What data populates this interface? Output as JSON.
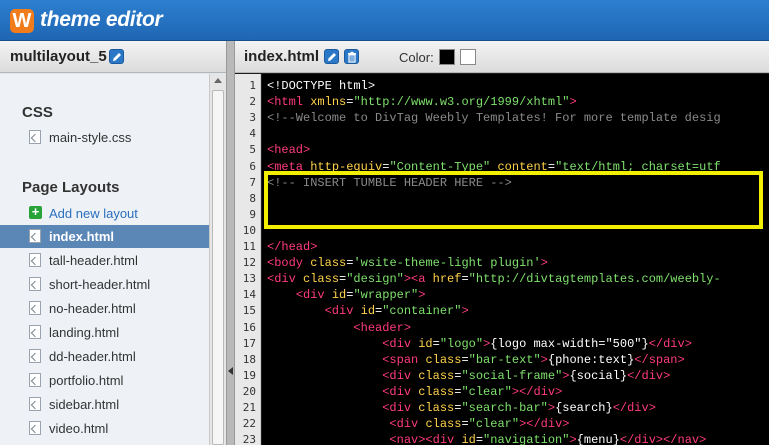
{
  "app": {
    "logo_letter": "W",
    "title": "theme editor"
  },
  "sidebar": {
    "project_name": "multilayout_5",
    "css_section": "CSS",
    "css_files": [
      "main-style.css"
    ],
    "layouts_section": "Page Layouts",
    "add_layout_label": "Add new layout",
    "layout_files": [
      "index.html",
      "tall-header.html",
      "short-header.html",
      "no-header.html",
      "landing.html",
      "dd-header.html",
      "portfolio.html",
      "sidebar.html",
      "video.html"
    ],
    "selected_index": 0
  },
  "editor": {
    "file_name": "index.html",
    "color_label": "Color:",
    "swatches": [
      "#000000",
      "#ffffff"
    ],
    "highlight_color": "#f2ef00",
    "lines": [
      {
        "n": "1",
        "tokens": [
          [
            "text",
            "<!DOCTYPE html>"
          ]
        ]
      },
      {
        "n": "2",
        "tokens": [
          [
            "tag",
            "<html "
          ],
          [
            "attr",
            "xmlns"
          ],
          [
            "text",
            "="
          ],
          [
            "str",
            "\"http://www.w3.org/1999/xhtml\""
          ],
          [
            "tag",
            ">"
          ]
        ]
      },
      {
        "n": "3",
        "tokens": [
          [
            "comment",
            "<!--Welcome to DivTag Weebly Templates! For more template desig"
          ]
        ]
      },
      {
        "n": "4",
        "tokens": []
      },
      {
        "n": "5",
        "tokens": [
          [
            "tag",
            "<head>"
          ]
        ]
      },
      {
        "n": "6",
        "tokens": [
          [
            "tag",
            "<meta "
          ],
          [
            "attr",
            "http-equiv"
          ],
          [
            "text",
            "="
          ],
          [
            "str",
            "\"Content-Type\""
          ],
          [
            "text",
            " "
          ],
          [
            "attr",
            "content"
          ],
          [
            "text",
            "="
          ],
          [
            "str",
            "\"text/html; charset=utf"
          ]
        ]
      },
      {
        "n": "7",
        "tokens": [
          [
            "comment",
            "<!-- INSERT TUMBLE HEADER HERE -->"
          ]
        ]
      },
      {
        "n": "8",
        "tokens": []
      },
      {
        "n": "9",
        "tokens": []
      },
      {
        "n": "10",
        "tokens": []
      },
      {
        "n": "11",
        "tokens": [
          [
            "tag",
            "</head>"
          ]
        ]
      },
      {
        "n": "12",
        "tokens": [
          [
            "tag",
            "<body "
          ],
          [
            "attr",
            "class"
          ],
          [
            "text",
            "="
          ],
          [
            "str",
            "'wsite-theme-light plugin'"
          ],
          [
            "tag",
            ">"
          ]
        ]
      },
      {
        "n": "13",
        "tokens": [
          [
            "tag",
            "<div "
          ],
          [
            "attr",
            "class"
          ],
          [
            "text",
            "="
          ],
          [
            "str",
            "\"design\""
          ],
          [
            "tag",
            "><a "
          ],
          [
            "attr",
            "href"
          ],
          [
            "text",
            "="
          ],
          [
            "str",
            "\"http://divtagtemplates.com/weebly-"
          ]
        ]
      },
      {
        "n": "14",
        "tokens": [
          [
            "text",
            "    "
          ],
          [
            "tag",
            "<div "
          ],
          [
            "attr",
            "id"
          ],
          [
            "text",
            "="
          ],
          [
            "str",
            "\"wrapper\""
          ],
          [
            "tag",
            ">"
          ]
        ]
      },
      {
        "n": "15",
        "tokens": [
          [
            "text",
            "        "
          ],
          [
            "tag",
            "<div "
          ],
          [
            "attr",
            "id"
          ],
          [
            "text",
            "="
          ],
          [
            "str",
            "\"container\""
          ],
          [
            "tag",
            ">"
          ]
        ]
      },
      {
        "n": "16",
        "tokens": [
          [
            "text",
            "            "
          ],
          [
            "tag",
            "<header>"
          ]
        ]
      },
      {
        "n": "17",
        "tokens": [
          [
            "text",
            "                "
          ],
          [
            "tag",
            "<div "
          ],
          [
            "attr",
            "id"
          ],
          [
            "text",
            "="
          ],
          [
            "str",
            "\"logo\""
          ],
          [
            "tag",
            ">"
          ],
          [
            "tpl",
            "{logo max-width=\"500\"}"
          ],
          [
            "tag",
            "</div>"
          ]
        ]
      },
      {
        "n": "18",
        "tokens": [
          [
            "text",
            "                "
          ],
          [
            "tag",
            "<span "
          ],
          [
            "attr",
            "class"
          ],
          [
            "text",
            "="
          ],
          [
            "str",
            "\"bar-text\""
          ],
          [
            "tag",
            ">"
          ],
          [
            "tpl",
            "{phone:text}"
          ],
          [
            "tag",
            "</span>"
          ]
        ]
      },
      {
        "n": "19",
        "tokens": [
          [
            "text",
            "                "
          ],
          [
            "tag",
            "<div "
          ],
          [
            "attr",
            "class"
          ],
          [
            "text",
            "="
          ],
          [
            "str",
            "\"social-frame\""
          ],
          [
            "tag",
            ">"
          ],
          [
            "tpl",
            "{social}"
          ],
          [
            "tag",
            "</div>"
          ]
        ]
      },
      {
        "n": "20",
        "tokens": [
          [
            "text",
            "                "
          ],
          [
            "tag",
            "<div "
          ],
          [
            "attr",
            "class"
          ],
          [
            "text",
            "="
          ],
          [
            "str",
            "\"clear\""
          ],
          [
            "tag",
            "></div>"
          ]
        ]
      },
      {
        "n": "21",
        "tokens": [
          [
            "text",
            "                "
          ],
          [
            "tag",
            "<div "
          ],
          [
            "attr",
            "class"
          ],
          [
            "text",
            "="
          ],
          [
            "str",
            "\"search-bar\""
          ],
          [
            "tag",
            ">"
          ],
          [
            "tpl",
            "{search}"
          ],
          [
            "tag",
            "</div>"
          ]
        ]
      },
      {
        "n": "22",
        "tokens": [
          [
            "text",
            "                 "
          ],
          [
            "tag",
            "<div "
          ],
          [
            "attr",
            "class"
          ],
          [
            "text",
            "="
          ],
          [
            "str",
            "\"clear\""
          ],
          [
            "tag",
            "></div>"
          ]
        ]
      },
      {
        "n": "23",
        "tokens": [
          [
            "text",
            "                 "
          ],
          [
            "tag",
            "<nav><div "
          ],
          [
            "attr",
            "id"
          ],
          [
            "text",
            "="
          ],
          [
            "str",
            "\"navigation\""
          ],
          [
            "tag",
            ">"
          ],
          [
            "tpl",
            "{menu}"
          ],
          [
            "tag",
            "</div></nav>"
          ]
        ]
      }
    ]
  }
}
